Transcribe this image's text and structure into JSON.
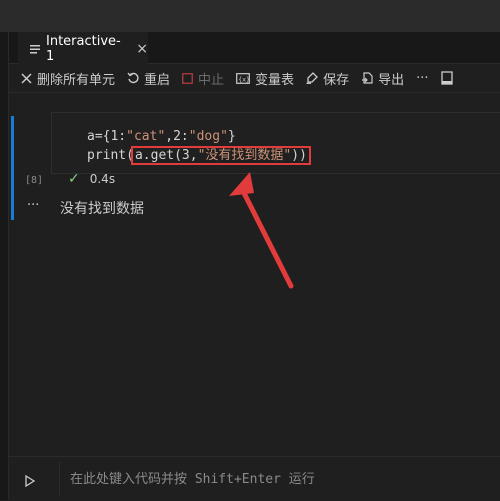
{
  "tab": {
    "title": "Interactive-1",
    "close_glyph": "×"
  },
  "toolbar": {
    "clear_all": "删除所有单元",
    "restart": "重启",
    "interrupt": "中止",
    "variables": "变量表",
    "save": "保存",
    "export": "导出",
    "more": "···"
  },
  "cell": {
    "line1_prefix": "a={1:",
    "line1_s1": "\"cat\"",
    "line1_mid": ",2:",
    "line1_s2": "\"dog\"",
    "line1_suffix": "}",
    "line2_prefix": "print(",
    "line2_hl_code": "a.get(3,",
    "line2_hl_str": "\"没有找到数据\"",
    "line2_suffix": "))",
    "exec_count": "[8]",
    "duration": "0.4s"
  },
  "output": {
    "dots": "···",
    "text": "没有找到数据"
  },
  "input": {
    "placeholder": "在此处键入代码并按 Shift+Enter 运行"
  },
  "colors": {
    "accent": "#1a7ad4",
    "highlight": "#e23b3b",
    "success": "#89d185",
    "string": "#ce9178"
  }
}
